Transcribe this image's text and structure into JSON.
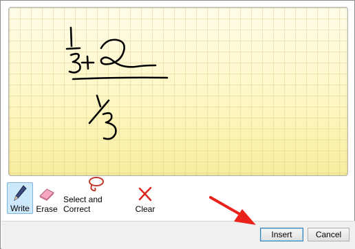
{
  "toolbar": {
    "write_label": "Write",
    "erase_label": "Erase",
    "select_correct_label": "Select and Correct",
    "clear_label": "Clear"
  },
  "footer": {
    "insert_label": "Insert",
    "cancel_label": "Cancel"
  },
  "colors": {
    "canvas_bg": "#fdf7c8",
    "grid_line": "#e3d49a",
    "ink": "#000000",
    "annotation_arrow": "#e8231c",
    "active_tool_bg": "#cde8fb"
  },
  "icons": {
    "write": "pen-icon",
    "erase": "eraser-icon",
    "select_correct": "lasso-icon",
    "clear": "clear-x-icon"
  }
}
